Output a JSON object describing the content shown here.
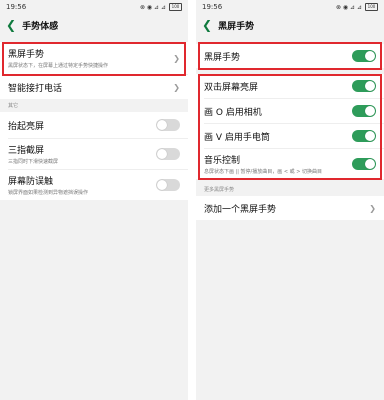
{
  "left": {
    "status": {
      "time": "19:56",
      "carrier": "五 ▲",
      "net": "⊗ ◉ ⊿ ⊿",
      "battery": "100"
    },
    "title": "手势体感",
    "top_items": [
      {
        "label": "黑屏手势",
        "sub": "黑屏状态下，在屏幕上通过特定手势快捷操作"
      },
      {
        "label": "智能接打电话",
        "sub": ""
      }
    ],
    "section_other": "其它",
    "other_items": [
      {
        "label": "抬起亮屏",
        "sub": "",
        "on": false
      },
      {
        "label": "三指截屏",
        "sub": "三指同时下滑快速截屏",
        "on": false
      },
      {
        "label": "屏幕防误触",
        "sub": "锁屏界面如果检测到异物遮挡误操作",
        "on": false
      }
    ]
  },
  "right": {
    "status": {
      "time": "19:56",
      "carrier": "五 ▲",
      "net": "⊗ ◉ ⊿ ⊿",
      "battery": "100"
    },
    "title": "黑屏手势",
    "master": {
      "label": "黑屏手势",
      "on": true
    },
    "gestures": [
      {
        "label": "双击屏幕亮屏",
        "sub": "",
        "on": true
      },
      {
        "label": "画 O 启用相机",
        "sub": "",
        "on": true
      },
      {
        "label": "画 V 启用手电筒",
        "sub": "",
        "on": true
      },
      {
        "label": "音乐控制",
        "sub": "息屏状态下画 || 暂停/播放曲目，画 < 或 > 切换曲目",
        "on": true
      }
    ],
    "section_more": "更多黑屏手势",
    "add_label": "添加一个黑屏手势"
  },
  "colors": {
    "accent": "#2e9c5a",
    "highlight": "#e0282e",
    "back": "#0f7a3e"
  }
}
